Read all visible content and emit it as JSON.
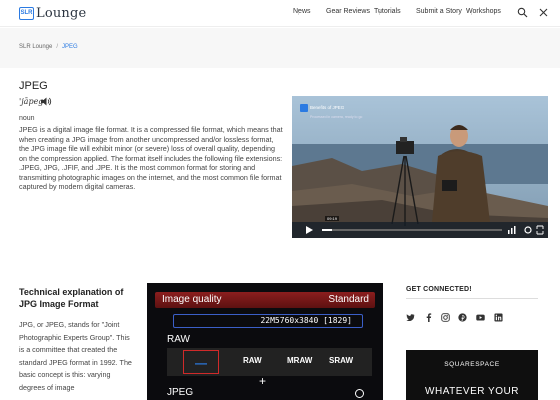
{
  "header": {
    "logo_badge": "SLR",
    "logo_text": "Lounge",
    "nav": [
      {
        "label": "News",
        "has_menu": true
      },
      {
        "label": "Gear Reviews",
        "has_menu": false
      },
      {
        "label": "Tutorials",
        "has_menu": true
      },
      {
        "label": "Submit a Story",
        "has_menu": false
      },
      {
        "label": "Workshops",
        "has_menu": true
      }
    ],
    "menu_glyph": "⋮"
  },
  "breadcrumb": {
    "home": "SLR Lounge",
    "separator": "/",
    "current": "JPEG"
  },
  "entry": {
    "title": "JPEG",
    "phonetic": "'jāpeg",
    "part_of_speech": "noun",
    "definition": "JPEG is a digital image file format. It is a compressed file format, which means that when creating a JPG image from another uncompressed and/or lossless format, the JPG image file will exhibit minor (or severe) loss of overall quality, depending on the compression applied. The format itself includes the following file extensions: .JPEG, JPG, .JFIF, and .JPE. It is the most common format for storing and transmitting photographic images on the internet, and the most common file format captured by modern digital cameras."
  },
  "video": {
    "title": "Benefits of JPEG",
    "subtitle": "Processed in camera, ready to go",
    "time": "09:19"
  },
  "section": {
    "title": "Technical explanation of JPG Image Format",
    "text": "JPG, or JPEG, stands for \"Joint Photographic Experts Group\". This is a committee that created the standard JPEG format in 1992. The basic concept is this: varying degrees of image"
  },
  "camera_screen": {
    "label": "Image quality",
    "value": "Standard",
    "resolution": "22M5760x3840 [1829]",
    "raw_label": "RAW",
    "options": [
      "—",
      "RAW",
      "MRAW",
      "SRAW"
    ],
    "plus": "+",
    "jpeg_label": "JPEG"
  },
  "sidebar": {
    "heading": "GET CONNECTED!",
    "social": [
      "twitter-icon",
      "facebook-icon",
      "instagram-icon",
      "pinterest-icon",
      "youtube-icon",
      "linkedin-icon"
    ],
    "ad_brand": "SQUARESPACE",
    "ad_headline": "WHATEVER YOUR"
  },
  "colors": {
    "accent": "#2a7ae2",
    "camera_bar": "#8b1e1e",
    "ad_bg": "#0f0f0f"
  }
}
